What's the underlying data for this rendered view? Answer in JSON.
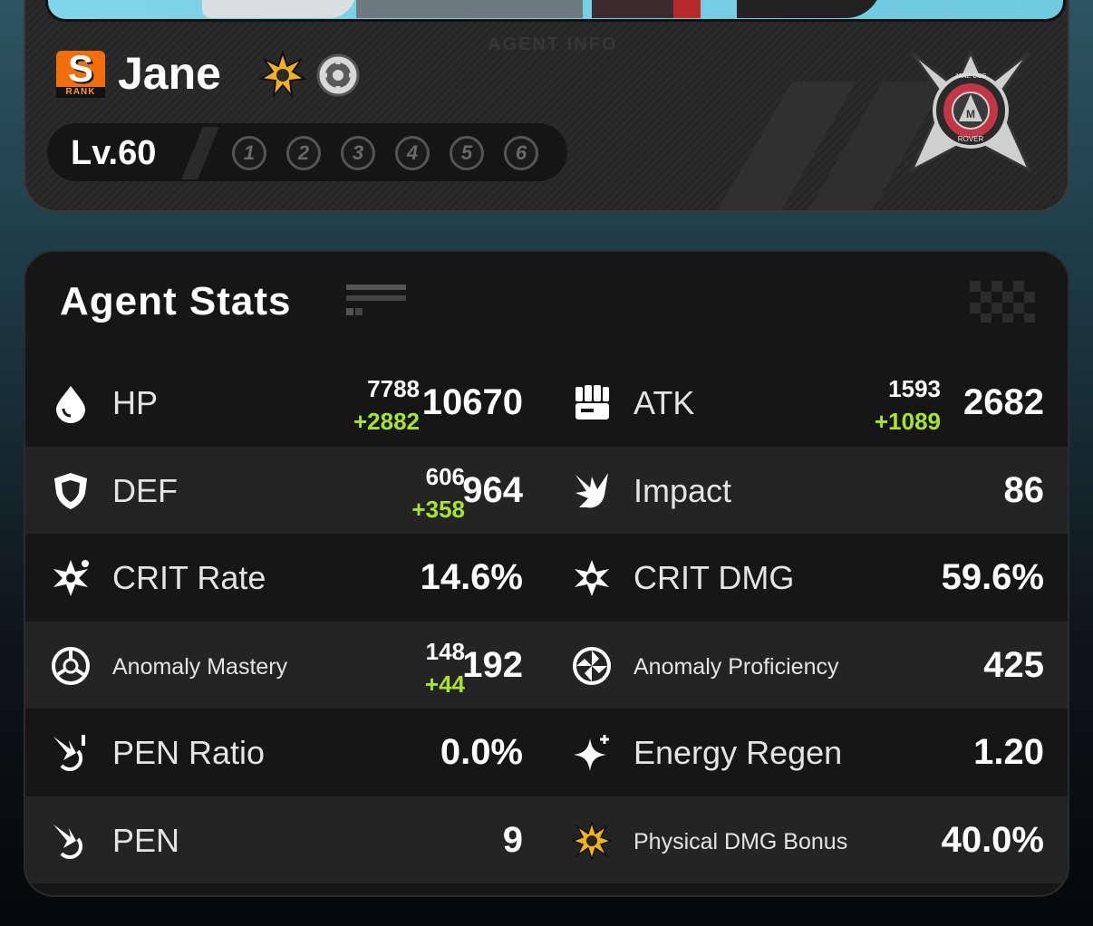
{
  "agent": {
    "name": "Jane",
    "rank": "S",
    "rank_sub": "RANK",
    "level": "Lv.60",
    "watermark": "AGENT INFO",
    "constellations": [
      "1",
      "2",
      "3",
      "4",
      "5",
      "6"
    ],
    "emblem_text": [
      "JANE DOE",
      "M",
      "ROVER"
    ],
    "attribute_icon": "physical-attribute-icon",
    "faction_icon": "faction-icon"
  },
  "stats": {
    "title": "Agent Stats",
    "rows": [
      {
        "left": {
          "label": "HP",
          "icon": "hp-drop-icon",
          "base": "7788",
          "bonus": "+2882",
          "value": "10670"
        },
        "right": {
          "label": "ATK",
          "icon": "atk-fist-icon",
          "base": "1593",
          "bonus": "+1089",
          "value": "2682"
        }
      },
      {
        "left": {
          "label": "DEF",
          "icon": "def-shield-icon",
          "base": "606",
          "bonus": "+358",
          "value": "964"
        },
        "right": {
          "label": "Impact",
          "icon": "impact-icon",
          "value": "86"
        }
      },
      {
        "left": {
          "label": "CRIT Rate",
          "icon": "crit-rate-icon",
          "value": "14.6%"
        },
        "right": {
          "label": "CRIT DMG",
          "icon": "crit-dmg-icon",
          "value": "59.6%"
        }
      },
      {
        "left": {
          "label": "Anomaly Mastery",
          "icon": "anomaly-mastery-icon",
          "base": "148",
          "bonus": "+44",
          "value": "192"
        },
        "right": {
          "label": "Anomaly Proficiency",
          "icon": "anomaly-proficiency-icon",
          "value": "425"
        }
      },
      {
        "left": {
          "label": "PEN Ratio",
          "icon": "pen-ratio-icon",
          "value": "0.0%"
        },
        "right": {
          "label": "Energy Regen",
          "icon": "energy-regen-icon",
          "value": "1.20"
        }
      },
      {
        "left": {
          "label": "PEN",
          "icon": "pen-icon",
          "value": "9"
        },
        "right": {
          "label": "Physical DMG Bonus",
          "icon": "physical-dmg-bonus-icon",
          "value": "40.0%"
        }
      }
    ]
  },
  "colors": {
    "bonus": "#a5e62c",
    "rank": "#f06f0c",
    "physical": "#f2b21b"
  }
}
